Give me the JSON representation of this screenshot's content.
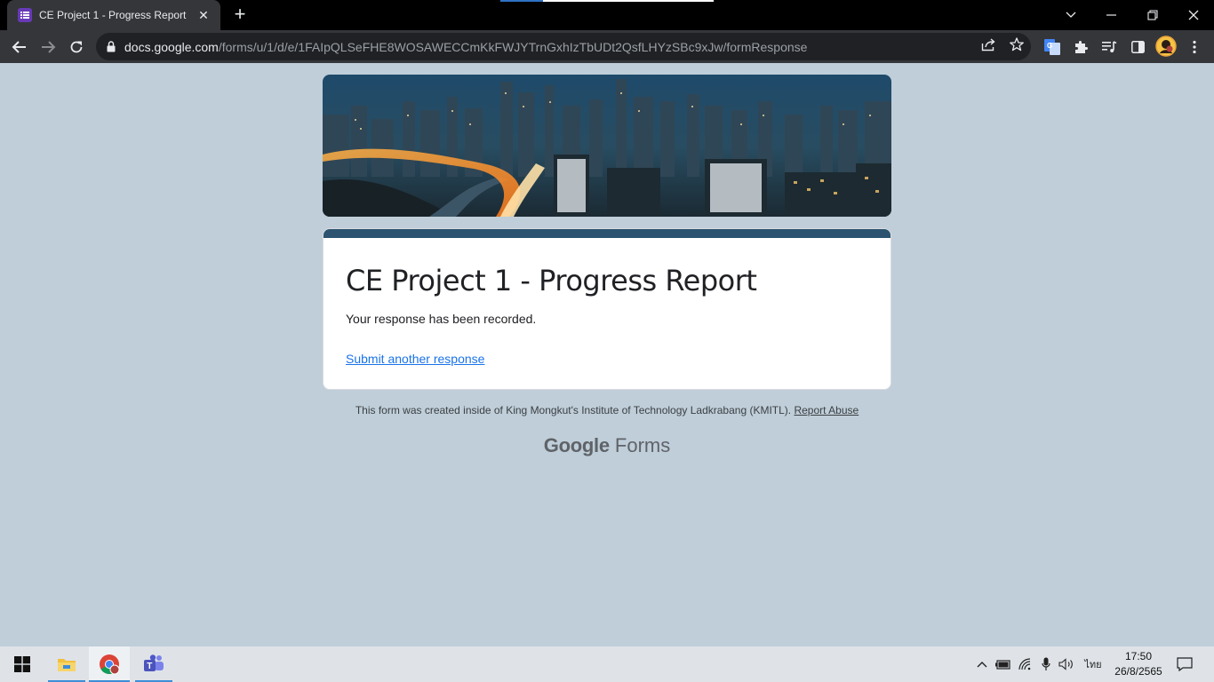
{
  "browser": {
    "tab_title": "CE Project 1 - Progress Report",
    "tab_close": "✕",
    "new_tab": "+",
    "url_host": "docs.google.com",
    "url_path": "/forms/u/1/d/e/1FAIpQLSeFHE8WOSAWECCmKkFWJYTrnGxhIzTbUDt2QsfLHYzSBc9xJw/formResponse"
  },
  "page": {
    "form_title": "CE Project 1 - Progress Report",
    "confirmation": "Your response has been recorded.",
    "submit_another": "Submit another response",
    "footer_text": "This form was created inside of King Mongkut's Institute of Technology Ladkrabang (KMITL).",
    "report_abuse": "Report Abuse",
    "brand_google": "Google",
    "brand_forms": "Forms"
  },
  "taskbar": {
    "time": "17:50",
    "date": "26/8/2565",
    "language": "ไทย"
  },
  "colors": {
    "page_background": "#bfced9",
    "card_accent": "#2c5470",
    "link": "#1a73e8",
    "chrome_dark": "#35363a"
  },
  "icons": [
    "forms-icon",
    "back-arrow-icon",
    "forward-arrow-icon",
    "reload-icon",
    "lock-icon",
    "share-icon",
    "star-icon",
    "translate-icon",
    "extensions-icon",
    "media-icon",
    "side-panel-icon",
    "profile-avatar",
    "menu-icon",
    "windows-start-icon",
    "file-explorer-icon",
    "chrome-icon",
    "teams-icon"
  ]
}
